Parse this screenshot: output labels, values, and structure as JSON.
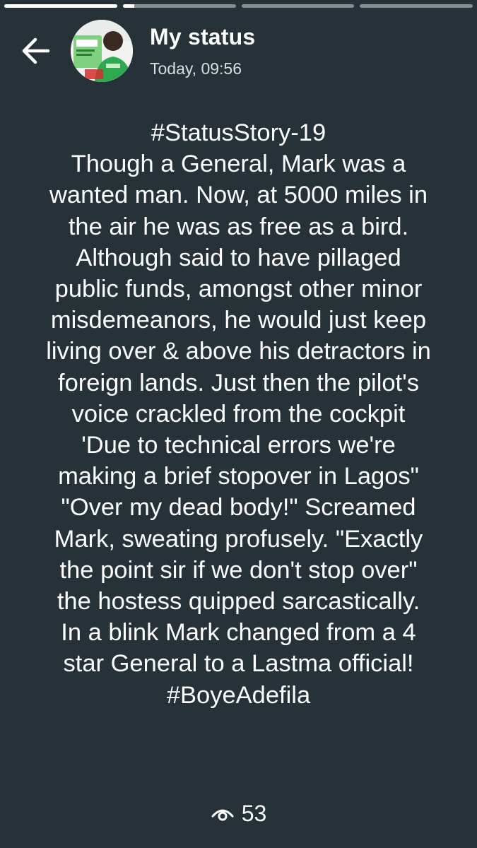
{
  "progress": {
    "segments": [
      {
        "fill_fraction": 1.0
      },
      {
        "fill_fraction": 0.1
      },
      {
        "fill_fraction": 0.0
      },
      {
        "fill_fraction": 0.0
      }
    ]
  },
  "header": {
    "back_icon": "arrow-left-icon",
    "avatar_icon": "profile-photo",
    "title": "My status",
    "time": "Today, 09:56"
  },
  "story": {
    "lines": [
      "#StatusStory-19",
      "Though a General, Mark was a",
      "wanted man. Now, at 5000 miles in",
      "the air he was as free as a bird.",
      "Although said to have pillaged",
      "public funds, amongst other minor",
      "misdemeanors, he would just keep",
      "living over & above his detractors in",
      "foreign lands. Just then the pilot's",
      "voice crackled from the cockpit",
      "'Due to technical errors we're",
      "making a brief stopover in Lagos\"",
      "\"Over my dead body!\" Screamed",
      "Mark, sweating profusely. \"Exactly",
      "the point sir if we don't stop over\"",
      "the hostess quipped sarcastically.",
      "In a blink Mark changed from a 4",
      "star General to a Lastma official!",
      "#BoyeAdefila"
    ]
  },
  "views": {
    "icon": "eye-icon",
    "count": "53"
  },
  "colors": {
    "background": "#263238",
    "text": "#ffffff",
    "subtext": "#d9dddf"
  }
}
